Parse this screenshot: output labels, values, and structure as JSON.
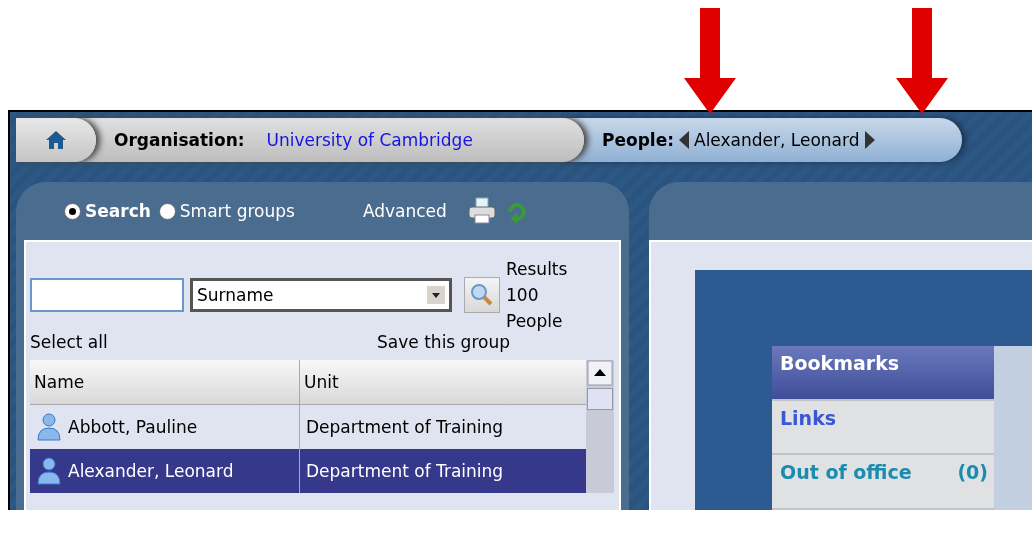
{
  "breadcrumb": {
    "organisation_label": "Organisation:",
    "organisation": "University of Cambridge",
    "people_label": "People:",
    "person": "Alexander, Leonard"
  },
  "left_panel": {
    "modes": [
      {
        "label": "Search",
        "selected": true
      },
      {
        "label": "Smart groups",
        "selected": false
      }
    ],
    "advanced": "Advanced",
    "field": "Surname",
    "results": "Results 100 People",
    "select_all": "Select all",
    "save_group": "Save this group"
  },
  "table": {
    "columns": [
      "Name",
      "Unit"
    ],
    "rows": [
      {
        "name": "Abbott, Pauline",
        "unit": "Department of Training",
        "selected": false
      },
      {
        "name": "Alexander, Leonard",
        "unit": "Department of Training",
        "selected": true
      }
    ]
  },
  "bookmarks": {
    "items": [
      {
        "label": "Bookmarks",
        "kind": "header"
      },
      {
        "label": "Links",
        "kind": "link"
      },
      {
        "label": "Out of office",
        "count": "(0)",
        "kind": "status"
      }
    ]
  }
}
